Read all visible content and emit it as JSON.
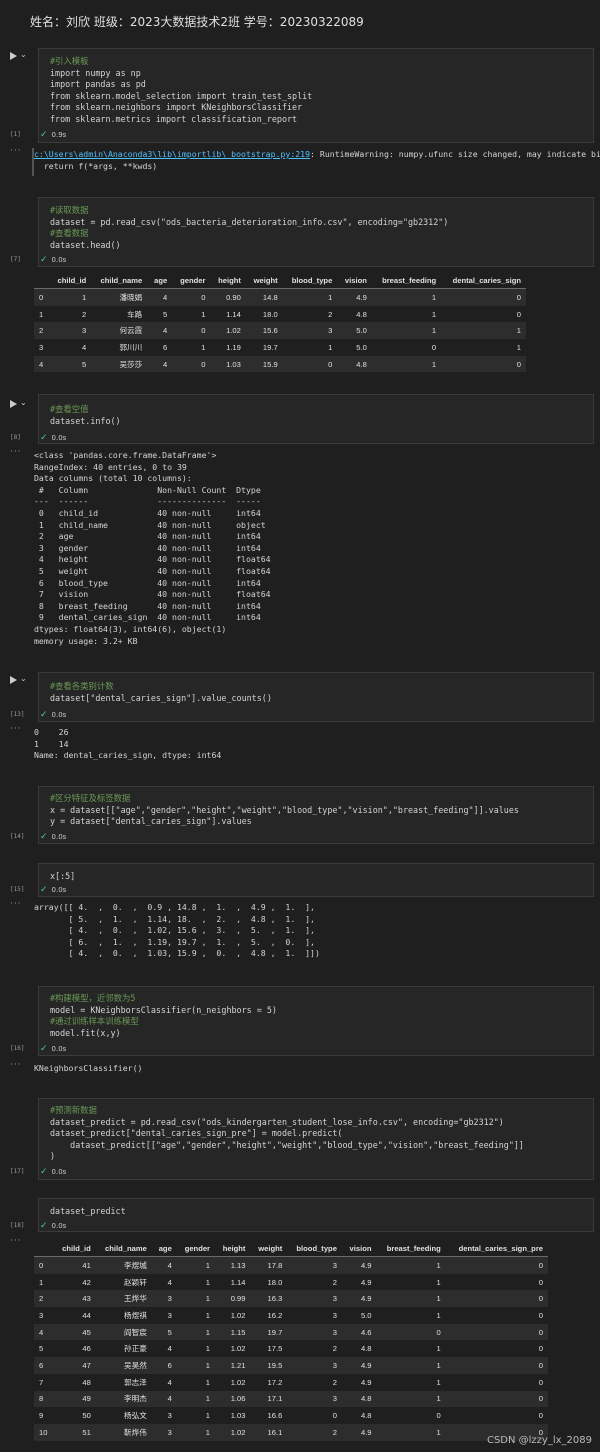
{
  "header": {
    "text": "姓名：刘欣 班级：2023大数据技术2班 学号：20230322089"
  },
  "cells": {
    "c1": {
      "exec": "[1]",
      "time": "0.9s",
      "lines": [
        "#引入模板",
        "import numpy as np",
        "import pandas as pd",
        "from sklearn.model_selection import train_test_split",
        "from sklearn.neighbors import KNeighborsClassifier",
        "from sklearn.metrics import classification_report"
      ],
      "output": {
        "link": "c:\\Users\\admin\\Anaconda3\\lib\\importlib\\_bootstrap.py:219",
        "rest": ": RuntimeWarning: numpy.ufunc size changed, may indicate binary",
        "line2": "  return f(*args, **kwds)"
      }
    },
    "c7": {
      "exec": "[7]",
      "time": "0.0s",
      "lines": [
        "#读取数据",
        "dataset = pd.read_csv(\"ods_bacteria_deterioration_info.csv\", encoding=\"gb2312\")",
        "#查看数据",
        "dataset.head()"
      ]
    },
    "c8": {
      "exec": "[8]",
      "time": "0.0s",
      "lines": [
        "#查看空值",
        "dataset.info()"
      ],
      "output": "<class 'pandas.core.frame.DataFrame'>\nRangeIndex: 40 entries, 0 to 39\nData columns (total 10 columns):\n #   Column              Non-Null Count  Dtype  \n---  ------              --------------  -----  \n 0   child_id            40 non-null     int64  \n 1   child_name          40 non-null     object \n 2   age                 40 non-null     int64  \n 3   gender              40 non-null     int64  \n 4   height              40 non-null     float64\n 5   weight              40 non-null     float64\n 6   blood_type          40 non-null     int64  \n 7   vision              40 non-null     float64\n 8   breast_feeding      40 non-null     int64  \n 9   dental_caries_sign  40 non-null     int64  \ndtypes: float64(3), int64(6), object(1)\nmemory usage: 3.2+ KB"
    },
    "c13": {
      "exec": "[13]",
      "time": "0.0s",
      "lines": [
        "#查看各类别计数",
        "dataset[\"dental_caries_sign\"].value_counts()"
      ],
      "output": "0    26\n1    14\nName: dental_caries_sign, dtype: int64"
    },
    "c14": {
      "exec": "[14]",
      "time": "0.0s",
      "lines": [
        "#区分特征及标签数据",
        "x = dataset[[\"age\",\"gender\",\"height\",\"weight\",\"blood_type\",\"vision\",\"breast_feeding\"]].values",
        "y = dataset[\"dental_caries_sign\"].values"
      ]
    },
    "c15": {
      "exec": "[15]",
      "time": "0.0s",
      "lines": [
        "x[:5]"
      ],
      "output": "array([[ 4.  ,  0.  ,  0.9 , 14.8 ,  1.  ,  4.9 ,  1.  ],\n       [ 5.  ,  1.  ,  1.14, 18.  ,  2.  ,  4.8 ,  1.  ],\n       [ 4.  ,  0.  ,  1.02, 15.6 ,  3.  ,  5.  ,  1.  ],\n       [ 6.  ,  1.  ,  1.19, 19.7 ,  1.  ,  5.  ,  0.  ],\n       [ 4.  ,  0.  ,  1.03, 15.9 ,  0.  ,  4.8 ,  1.  ]])"
    },
    "c16": {
      "exec": "[16]",
      "time": "0.0s",
      "lines": [
        "#构建模型，近邻数为5",
        "model = KNeighborsClassifier(n_neighbors = 5)",
        "#通过训练样本训练模型",
        "model.fit(x,y)"
      ],
      "output": "KNeighborsClassifier()"
    },
    "c17": {
      "exec": "[17]",
      "time": "0.0s",
      "lines": [
        "#预测新数据",
        "dataset_predict = pd.read_csv(\"ods_kindergarten_student_lose_info.csv\", encoding=\"gb2312\")",
        "dataset_predict[\"dental_caries_sign_pre\"] = model.predict(",
        "    dataset_predict[[\"age\",\"gender\",\"height\",\"weight\",\"blood_type\",\"vision\",\"breast_feeding\"]]",
        ")"
      ]
    },
    "c18": {
      "exec": "[18]",
      "time": "0.0s",
      "lines": [
        "dataset_predict"
      ]
    }
  },
  "table1": {
    "columns": [
      "",
      "child_id",
      "child_name",
      "age",
      "gender",
      "height",
      "weight",
      "blood_type",
      "vision",
      "breast_feeding",
      "dental_caries_sign"
    ],
    "rows": [
      [
        "0",
        "1",
        "潘晓娟",
        "4",
        "0",
        "0.90",
        "14.8",
        "1",
        "4.9",
        "1",
        "0"
      ],
      [
        "1",
        "2",
        "车路",
        "5",
        "1",
        "1.14",
        "18.0",
        "2",
        "4.8",
        "1",
        "0"
      ],
      [
        "2",
        "3",
        "何云霞",
        "4",
        "0",
        "1.02",
        "15.6",
        "3",
        "5.0",
        "1",
        "1"
      ],
      [
        "3",
        "4",
        "郭川川",
        "6",
        "1",
        "1.19",
        "19.7",
        "1",
        "5.0",
        "0",
        "1"
      ],
      [
        "4",
        "5",
        "吴莎莎",
        "4",
        "0",
        "1.03",
        "15.9",
        "0",
        "4.8",
        "1",
        "0"
      ]
    ]
  },
  "table2": {
    "columns": [
      "",
      "child_id",
      "child_name",
      "age",
      "gender",
      "height",
      "weight",
      "blood_type",
      "vision",
      "breast_feeding",
      "dental_caries_sign_pre"
    ],
    "rows": [
      [
        "0",
        "41",
        "李煜城",
        "4",
        "1",
        "1.13",
        "17.8",
        "3",
        "4.9",
        "1",
        "0"
      ],
      [
        "1",
        "42",
        "赵颖轩",
        "4",
        "1",
        "1.14",
        "18.0",
        "2",
        "4.9",
        "1",
        "0"
      ],
      [
        "2",
        "43",
        "王烨华",
        "3",
        "1",
        "0.99",
        "16.3",
        "3",
        "4.9",
        "1",
        "0"
      ],
      [
        "3",
        "44",
        "杨煜祺",
        "3",
        "1",
        "1.02",
        "16.2",
        "3",
        "5.0",
        "1",
        "0"
      ],
      [
        "4",
        "45",
        "阎智宸",
        "5",
        "1",
        "1.15",
        "19.7",
        "3",
        "4.6",
        "0",
        "0"
      ],
      [
        "5",
        "46",
        "孙正豪",
        "4",
        "1",
        "1.02",
        "17.5",
        "2",
        "4.8",
        "1",
        "0"
      ],
      [
        "6",
        "47",
        "吴昊然",
        "6",
        "1",
        "1.21",
        "19.5",
        "3",
        "4.9",
        "1",
        "0"
      ],
      [
        "7",
        "48",
        "郭志泽",
        "4",
        "1",
        "1.02",
        "17.2",
        "2",
        "4.9",
        "1",
        "0"
      ],
      [
        "8",
        "49",
        "李明杰",
        "4",
        "1",
        "1.06",
        "17.1",
        "3",
        "4.8",
        "1",
        "0"
      ],
      [
        "9",
        "50",
        "杨弘文",
        "3",
        "1",
        "1.03",
        "16.6",
        "0",
        "4.8",
        "0",
        "0"
      ],
      [
        "10",
        "51",
        "靳烨伟",
        "3",
        "1",
        "1.02",
        "16.1",
        "2",
        "4.9",
        "1",
        "0"
      ]
    ]
  },
  "watermark": "CSDN @lzzy_lx_2089",
  "icons": {
    "run": "run-icon",
    "chevron": "chevron-down-icon",
    "check": "check-icon",
    "more": "more-icon"
  }
}
